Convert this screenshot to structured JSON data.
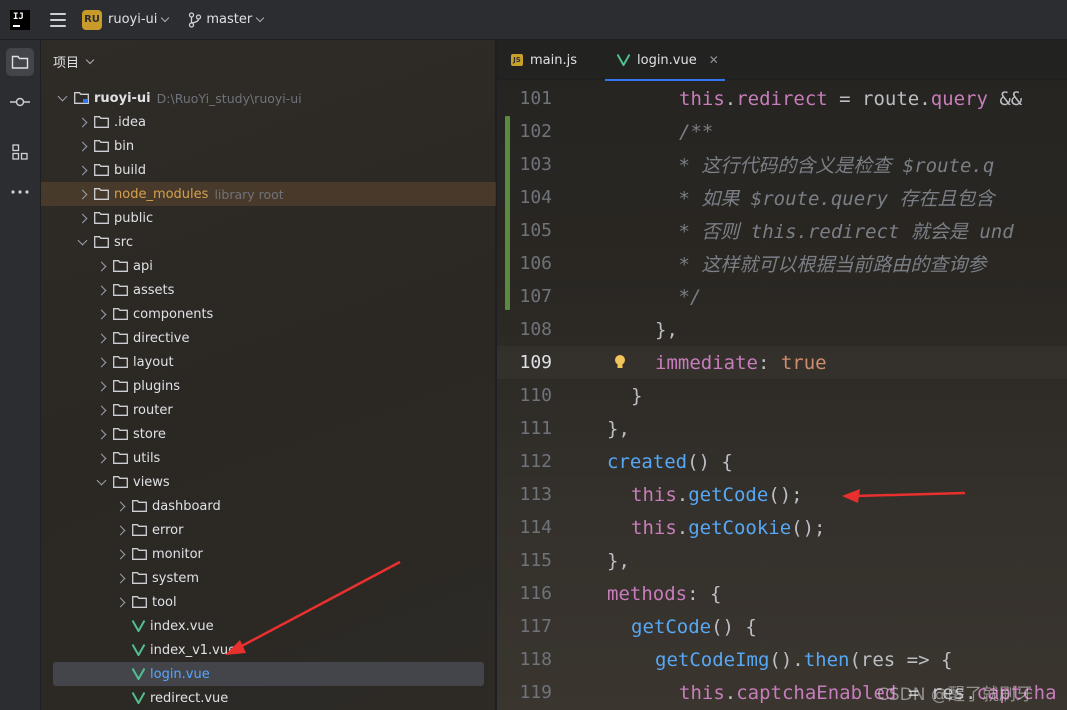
{
  "titlebar": {
    "app_logo": "IJ",
    "project_badge": "RU",
    "project_name": "ruoyi-ui",
    "branch_name": "master"
  },
  "toolstrip": {
    "items": [
      "folder-icon",
      "commit-icon",
      "structure-icon",
      "more-icon"
    ]
  },
  "project_panel": {
    "title": "项目",
    "root": {
      "label": "ruoyi-ui",
      "path": "D:\\RuoYi_study\\ruoyi-ui"
    },
    "nodes": [
      {
        "label": ".idea",
        "type": "folder"
      },
      {
        "label": "bin",
        "type": "folder"
      },
      {
        "label": "build",
        "type": "folder"
      },
      {
        "label": "node_modules",
        "type": "folder",
        "hint": "library root"
      },
      {
        "label": "public",
        "type": "folder"
      },
      {
        "label": "src",
        "type": "folder"
      },
      {
        "label": "api",
        "type": "folder"
      },
      {
        "label": "assets",
        "type": "folder"
      },
      {
        "label": "components",
        "type": "folder"
      },
      {
        "label": "directive",
        "type": "folder"
      },
      {
        "label": "layout",
        "type": "folder"
      },
      {
        "label": "plugins",
        "type": "folder"
      },
      {
        "label": "router",
        "type": "folder"
      },
      {
        "label": "store",
        "type": "folder"
      },
      {
        "label": "utils",
        "type": "folder"
      },
      {
        "label": "views",
        "type": "folder"
      },
      {
        "label": "dashboard",
        "type": "folder"
      },
      {
        "label": "error",
        "type": "folder"
      },
      {
        "label": "monitor",
        "type": "folder"
      },
      {
        "label": "system",
        "type": "folder"
      },
      {
        "label": "tool",
        "type": "folder"
      },
      {
        "label": "index.vue",
        "type": "vue"
      },
      {
        "label": "index_v1.vue",
        "type": "vue"
      },
      {
        "label": "login.vue",
        "type": "vue"
      },
      {
        "label": "redirect.vue",
        "type": "vue"
      }
    ]
  },
  "editor": {
    "tabs": [
      {
        "label": "main.js",
        "icon": "JS"
      },
      {
        "label": "login.vue",
        "active": true
      }
    ],
    "current_line": "109",
    "lines": [
      {
        "n": "101",
        "t": [
          "this",
          ".",
          "redirect",
          " = route.",
          "query",
          " &&"
        ]
      },
      {
        "n": "102",
        "t": [
          "/**"
        ]
      },
      {
        "n": "103",
        "t": [
          " * 这行代码的含义是检查 $route.q"
        ]
      },
      {
        "n": "104",
        "t": [
          " * 如果 $route.query 存在且包含"
        ]
      },
      {
        "n": "105",
        "t": [
          " * 否则 this.redirect 就会是 und"
        ]
      },
      {
        "n": "106",
        "t": [
          " * 这样就可以根据当前路由的查询参"
        ]
      },
      {
        "n": "107",
        "t": [
          " */"
        ]
      },
      {
        "n": "108",
        "t": [
          "},"
        ]
      },
      {
        "n": "109",
        "t": [
          "immediate",
          ": ",
          "true"
        ]
      },
      {
        "n": "110",
        "t": [
          "}"
        ]
      },
      {
        "n": "111",
        "t": [
          "},"
        ]
      },
      {
        "n": "112",
        "t": [
          "created",
          "() {"
        ]
      },
      {
        "n": "113",
        "t": [
          "this",
          ".",
          "getCode",
          "();"
        ]
      },
      {
        "n": "114",
        "t": [
          "this",
          ".",
          "getCookie",
          "();"
        ]
      },
      {
        "n": "115",
        "t": [
          "},"
        ]
      },
      {
        "n": "116",
        "t": [
          "methods",
          ": {"
        ]
      },
      {
        "n": "117",
        "t": [
          "getCode",
          "() {"
        ]
      },
      {
        "n": "118",
        "t": [
          "getCodeImg",
          "().",
          "then",
          "(res => {"
        ]
      },
      {
        "n": "119",
        "t": [
          "this",
          ".",
          "captchaEnabled",
          " = res.",
          "captcha"
        ]
      }
    ]
  },
  "watermark": "CSDN @醒了就刷牙"
}
